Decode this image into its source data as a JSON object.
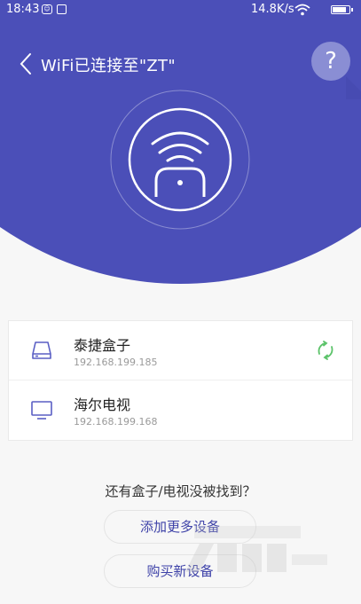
{
  "status_bar": {
    "time": "18:43",
    "network_speed": "14.8K/s",
    "battery_level": 0.85
  },
  "header": {
    "title": "WiFi已连接至\"ZT\"",
    "help_label": "?"
  },
  "devices": [
    {
      "name": "泰捷盒子",
      "ip": "192.168.199.185",
      "icon": "tv-box-icon",
      "status_icon": "link-icon"
    },
    {
      "name": "海尔电视",
      "ip": "192.168.199.168",
      "icon": "tv-icon"
    }
  ],
  "prompt": "还有盒子/电视没被找到？",
  "buttons": {
    "add_device": "添加更多设备",
    "buy_device": "购买新设备"
  },
  "colors": {
    "header_bg": "#4b4fb8",
    "accent": "#3e42a8",
    "link_green": "#5cc36a",
    "device_icon": "#5a5fc4"
  }
}
